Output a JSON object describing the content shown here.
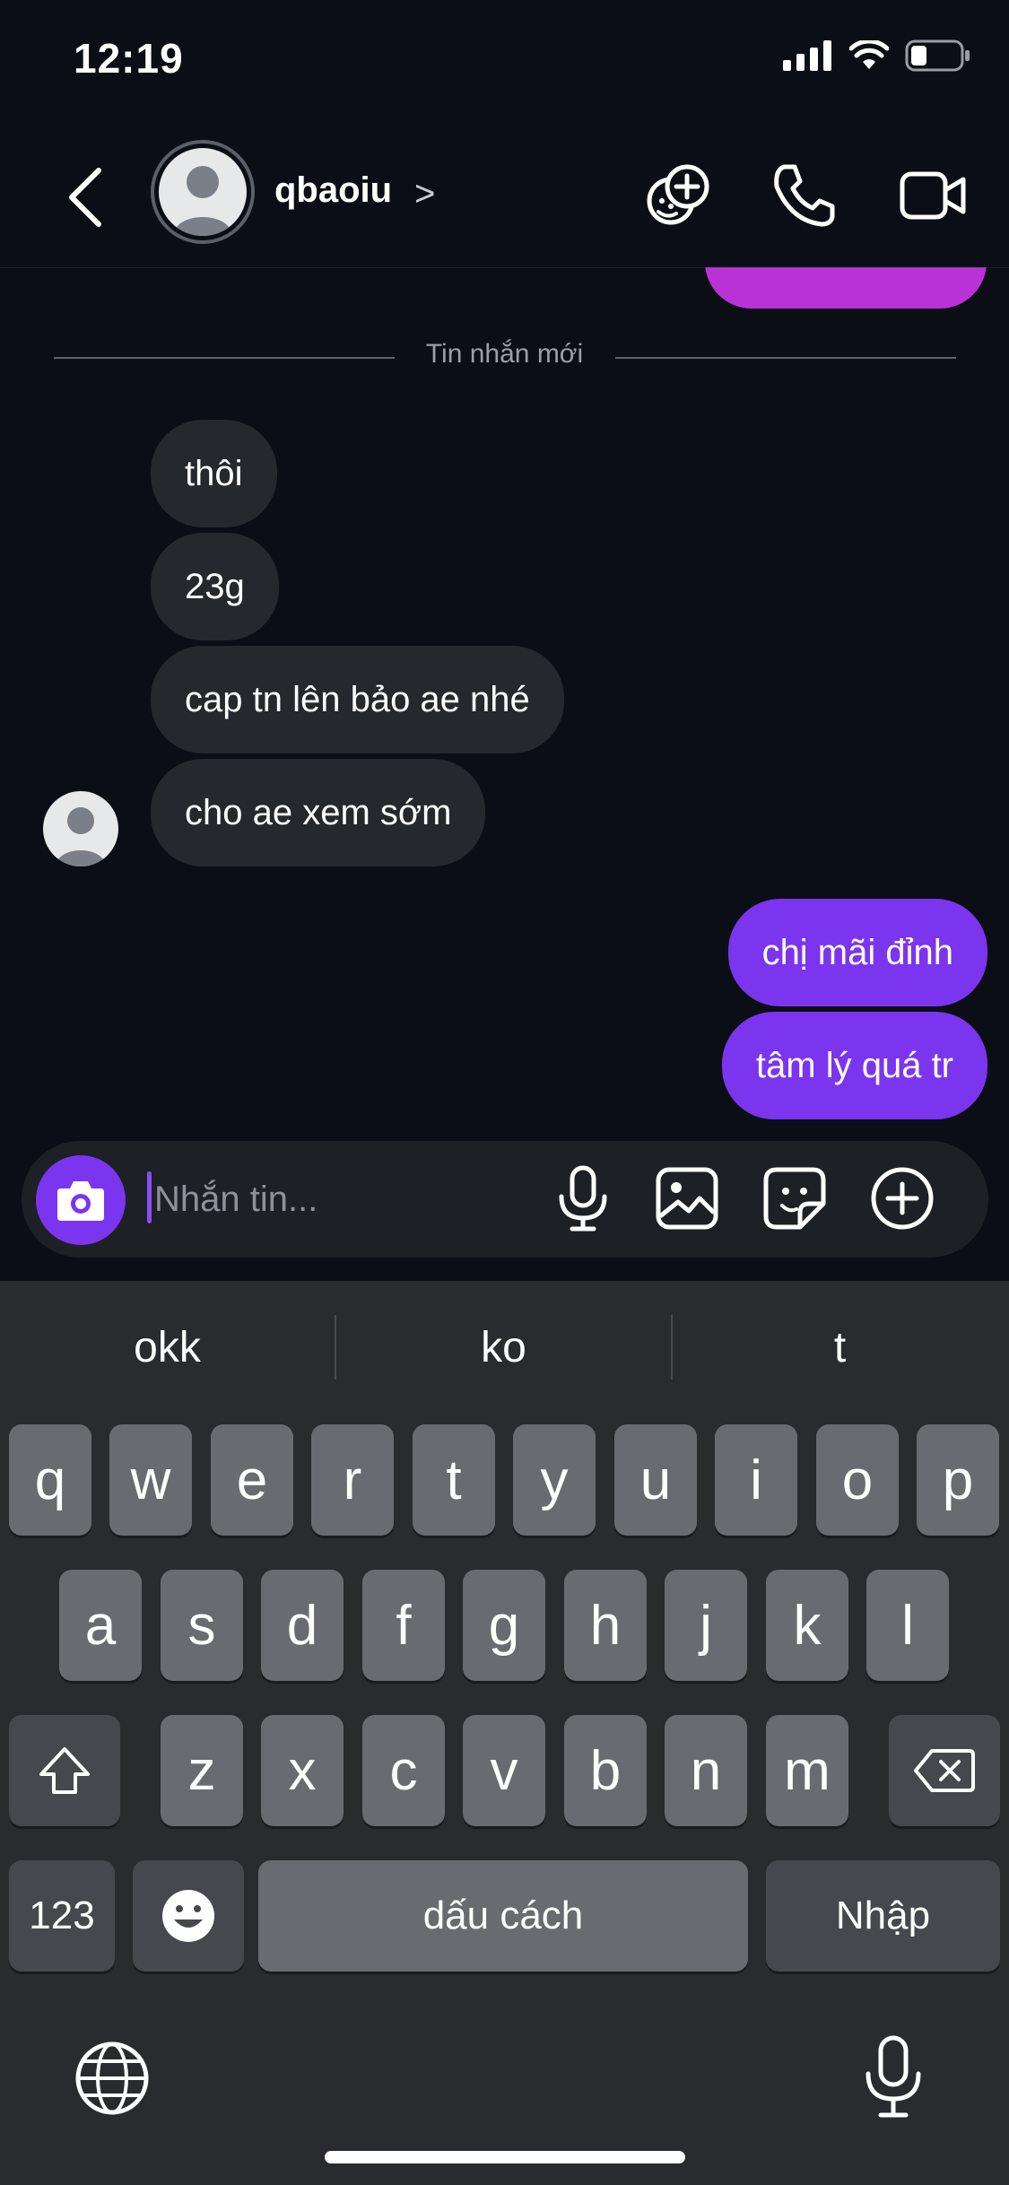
{
  "status": {
    "time": "12:19"
  },
  "header": {
    "username": "qbaoiu",
    "chevron": ">"
  },
  "divider": {
    "label": "Tin nhắn mới"
  },
  "messages": {
    "incoming": [
      "thôi",
      "23g",
      "cap tn lên bảo ae nhé",
      "cho ae xem sớm"
    ],
    "outgoing": [
      "chị mãi đỉnh",
      "tâm lý quá tr"
    ]
  },
  "composer": {
    "placeholder": "Nhắn tin..."
  },
  "keyboard": {
    "suggestions": [
      "okk",
      "ko",
      "t"
    ],
    "row1": [
      "q",
      "w",
      "e",
      "r",
      "t",
      "y",
      "u",
      "i",
      "o",
      "p"
    ],
    "row2": [
      "a",
      "s",
      "d",
      "f",
      "g",
      "h",
      "j",
      "k",
      "l"
    ],
    "row3": [
      "z",
      "x",
      "c",
      "v",
      "b",
      "n",
      "m"
    ],
    "numbers_label": "123",
    "space_label": "dấu cách",
    "enter_label": "Nhập"
  },
  "colors": {
    "accent": "#7b35ee",
    "incoming_bubble": "#25282d",
    "background": "#0b0e14"
  },
  "icons": [
    "back-icon",
    "avatar",
    "chevron-right-icon",
    "effects-icon",
    "phone-icon",
    "video-icon",
    "camera-icon",
    "microphone-icon",
    "gallery-icon",
    "sticker-icon",
    "plus-icon",
    "shift-icon",
    "delete-icon",
    "emoji-icon",
    "globe-icon",
    "dictation-icon",
    "signal-icon",
    "wifi-icon",
    "battery-icon"
  ]
}
